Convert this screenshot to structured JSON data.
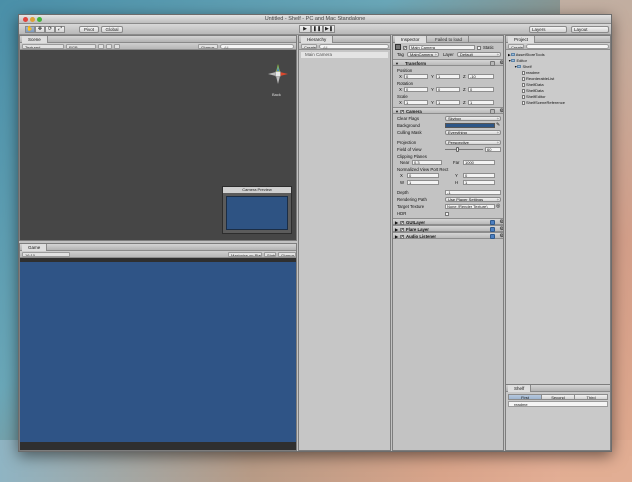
{
  "window": {
    "title": "Untitled - Shelf - PC and Mac Standalone"
  },
  "toolbar": {
    "tools": [
      "✋",
      "✥",
      "⟳",
      "⤢"
    ],
    "pivot_label": "Pivot",
    "global_label": "Global",
    "play": "▶",
    "pause": "❚❚",
    "step": "▶❚",
    "layers_label": "Layers",
    "layout_label": "Layout"
  },
  "scene": {
    "tab": "Scene",
    "render_mode": "Textured",
    "color_mode": "RGB",
    "gizmos_label": "Gizmos",
    "search_placeholder": "All",
    "gizmo_label": "Back",
    "camera_preview_title": "Camera Preview"
  },
  "game": {
    "tab": "Game",
    "aspect": "16:10",
    "maximize_label": "Maximize on Play",
    "stats_label": "Stats",
    "gizmos_label": "Gizmos"
  },
  "hierarchy": {
    "tab": "Hierarchy",
    "create_label": "Create",
    "search_placeholder": "All",
    "items": [
      "Main Camera"
    ]
  },
  "inspector": {
    "tab": "Inspector",
    "tab2": "Failed to load",
    "object_name": "Main Camera",
    "static_label": "Static",
    "tag_label": "Tag",
    "tag_value": "MainCamera",
    "layer_label": "Layer",
    "layer_value": "Default",
    "transform": {
      "title": "Transform",
      "position_label": "Position",
      "position": [
        "0",
        "1",
        "-10"
      ],
      "rotation_label": "Rotation",
      "rotation": [
        "0",
        "0",
        "0"
      ],
      "scale_label": "Scale",
      "scale": [
        "1",
        "1",
        "1"
      ],
      "axes": [
        "X",
        "Y",
        "Z"
      ]
    },
    "camera": {
      "title": "Camera",
      "clear_flags_label": "Clear Flags",
      "clear_flags": "Skybox",
      "background_label": "Background",
      "background_color": "#2d5687",
      "culling_mask_label": "Culling Mask",
      "culling_mask": "Everything",
      "projection_label": "Projection",
      "projection": "Perspective",
      "fov_label": "Field of View",
      "fov": "60",
      "fov_fraction": 0.33,
      "clipping_label": "Clipping Planes",
      "near_label": "Near",
      "near": "0.3",
      "far_label": "Far",
      "far": "1000",
      "viewport_label": "Normalized View Port Rect",
      "vp_x_label": "X",
      "vp_x": "0",
      "vp_y_label": "Y",
      "vp_y": "0",
      "vp_w_label": "W",
      "vp_w": "1",
      "vp_h_label": "H",
      "vp_h": "1",
      "depth_label": "Depth",
      "depth": "-1",
      "rendering_path_label": "Rendering Path",
      "rendering_path": "Use Player Settings",
      "target_texture_label": "Target Texture",
      "target_texture": "None (Render Texture)",
      "hdr_label": "HDR"
    },
    "components": [
      "GUILayer",
      "Flare Layer",
      "Audio Listener"
    ]
  },
  "project": {
    "tab": "Project",
    "create_label": "Create",
    "search_placeholder": "",
    "tree": [
      {
        "label": "AssetStoreTools",
        "type": "folder"
      },
      {
        "label": "Editor",
        "type": "folder"
      },
      {
        "label": "Shelf",
        "type": "folder"
      },
      {
        "label": "readme",
        "type": "file"
      },
      {
        "label": "ReorderableList",
        "type": "file"
      },
      {
        "label": "ShelfData",
        "type": "file"
      },
      {
        "label": "ShelfData",
        "type": "file"
      },
      {
        "label": "ShelfEditor",
        "type": "file"
      },
      {
        "label": "ShelfSceneReference",
        "type": "file"
      }
    ]
  },
  "shelf": {
    "tab": "Shelf",
    "tabs": [
      "First",
      "Second",
      "Third"
    ],
    "items": [
      "readme"
    ]
  },
  "colors": {
    "scene_bg": "#464646",
    "game_blue": "#2f5486",
    "selection": "#b7c9de"
  }
}
